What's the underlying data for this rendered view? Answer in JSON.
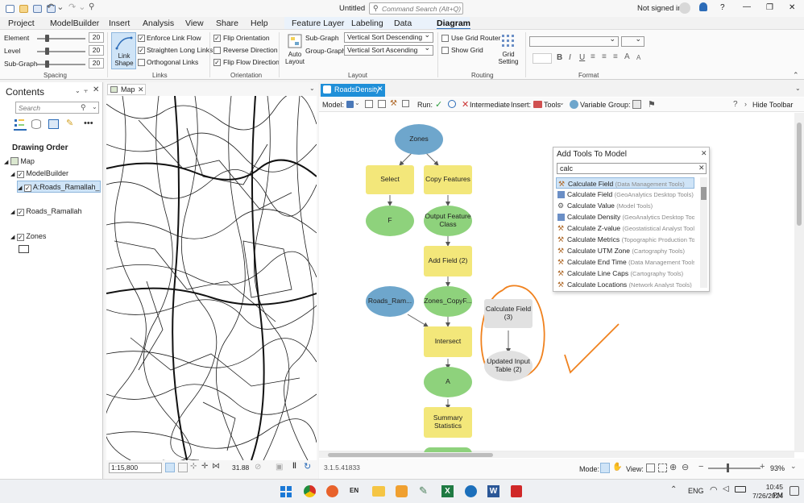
{
  "window": {
    "title": "Untitled",
    "search_placeholder": "Command Search (Alt+Q)",
    "signed_in": "Not signed in",
    "min": "—",
    "max": "❐",
    "close": "✕",
    "help": "?"
  },
  "menu": {
    "tabs": [
      "Project",
      "ModelBuilder",
      "Insert",
      "Analysis",
      "View",
      "Share",
      "Help",
      "Feature Layer",
      "Labeling",
      "Data",
      "Diagram"
    ]
  },
  "ribbon": {
    "spacing": {
      "element": "Element",
      "level": "Level",
      "subgraph": "Sub-Graph",
      "element_value": "20",
      "level_value": "20",
      "subgraph_value": "20",
      "group": "Spacing"
    },
    "links": {
      "link_shape": "Link Shape",
      "enforce": "Enforce Link Flow",
      "straighten": "Straighten Long Links",
      "orthogonal": "Orthogonal Links",
      "group": "Links"
    },
    "orientation": {
      "flip": "Flip Orientation",
      "reverse": "Reverse Direction",
      "flow": "Flip Flow Direction",
      "group": "Orientation"
    },
    "layout": {
      "auto": "Auto Layout",
      "subgraph": "Sub-Graph",
      "groupgraph": "Group-Graph",
      "subgraph_value": "Vertical Sort Descending",
      "groupgraph_value": "Vertical Sort Ascending",
      "group": "Layout"
    },
    "routing": {
      "use_grid": "Use Grid Router",
      "show_grid": "Show Grid",
      "grid_setting": "Grid Setting",
      "group": "Routing"
    },
    "format": {
      "group": "Format",
      "bold": "B",
      "italic": "I",
      "underline": "U"
    }
  },
  "contents": {
    "title": "Contents",
    "search_placeholder": "Search",
    "drawing_order": "Drawing Order",
    "items": [
      "Map",
      "ModelBuilder",
      "A:Roads_Ramallah_Int...",
      "Roads_Ramallah",
      "Zones"
    ]
  },
  "map_tab": {
    "label": "Map",
    "scale": "1:15,800",
    "coord": "31.88"
  },
  "model_tab": {
    "label": "RoadsDensity",
    "toolbar": {
      "model": "Model:",
      "run": "Run:",
      "intermediate": "Intermediate",
      "insert": "Insert:",
      "tools": "Tools",
      "variable": "Variable",
      "group": "Group:",
      "hide": "Hide Toolbar"
    },
    "nodes": {
      "zones": "Zones",
      "select": "Select",
      "copy": "Copy Features",
      "f": "F",
      "output": "Output Feature Class",
      "addfield": "Add Field (2)",
      "roads": "Roads_Ram...",
      "zones_copy": "Zones_CopyF...",
      "intersect": "Intersect",
      "a": "A",
      "summary": "Summary Statistics",
      "calc": "Calculate Field (3)",
      "updated": "Updated Input Table (2)"
    },
    "version": "3.1.5.41833",
    "mode": "Mode:",
    "view": "View:",
    "zoom": "93%"
  },
  "tool_popup": {
    "title": "Add Tools To Model",
    "query": "calc",
    "results": [
      {
        "name": "Calculate Field",
        "cat": "(Data Management Tools)"
      },
      {
        "name": "Calculate Field",
        "cat": "(GeoAnalytics Desktop Tools)"
      },
      {
        "name": "Calculate Value",
        "cat": "(Model Tools)"
      },
      {
        "name": "Calculate Density",
        "cat": "(GeoAnalytics Desktop Tools)"
      },
      {
        "name": "Calculate Z-value",
        "cat": "(Geostatistical Analyst Tools)"
      },
      {
        "name": "Calculate Metrics",
        "cat": "(Topographic Production Tools)"
      },
      {
        "name": "Calculate UTM Zone",
        "cat": "(Cartography Tools)"
      },
      {
        "name": "Calculate End Time",
        "cat": "(Data Management Tools)"
      },
      {
        "name": "Calculate Line Caps",
        "cat": "(Cartography Tools)"
      },
      {
        "name": "Calculate Locations",
        "cat": "(Network Analyst Tools)"
      }
    ]
  },
  "taskbar": {
    "lang": "ENG",
    "time": "10:45 PM",
    "date": "7/26/2024",
    "en": "EN"
  },
  "colors": {
    "accent": "#2c6cb8",
    "tab_blue": "#1f8fd8",
    "annot": "#f0811d",
    "blue_node": "#6ea6cc",
    "green_node": "#8ed27c",
    "yellow_node": "#f3e77a"
  }
}
